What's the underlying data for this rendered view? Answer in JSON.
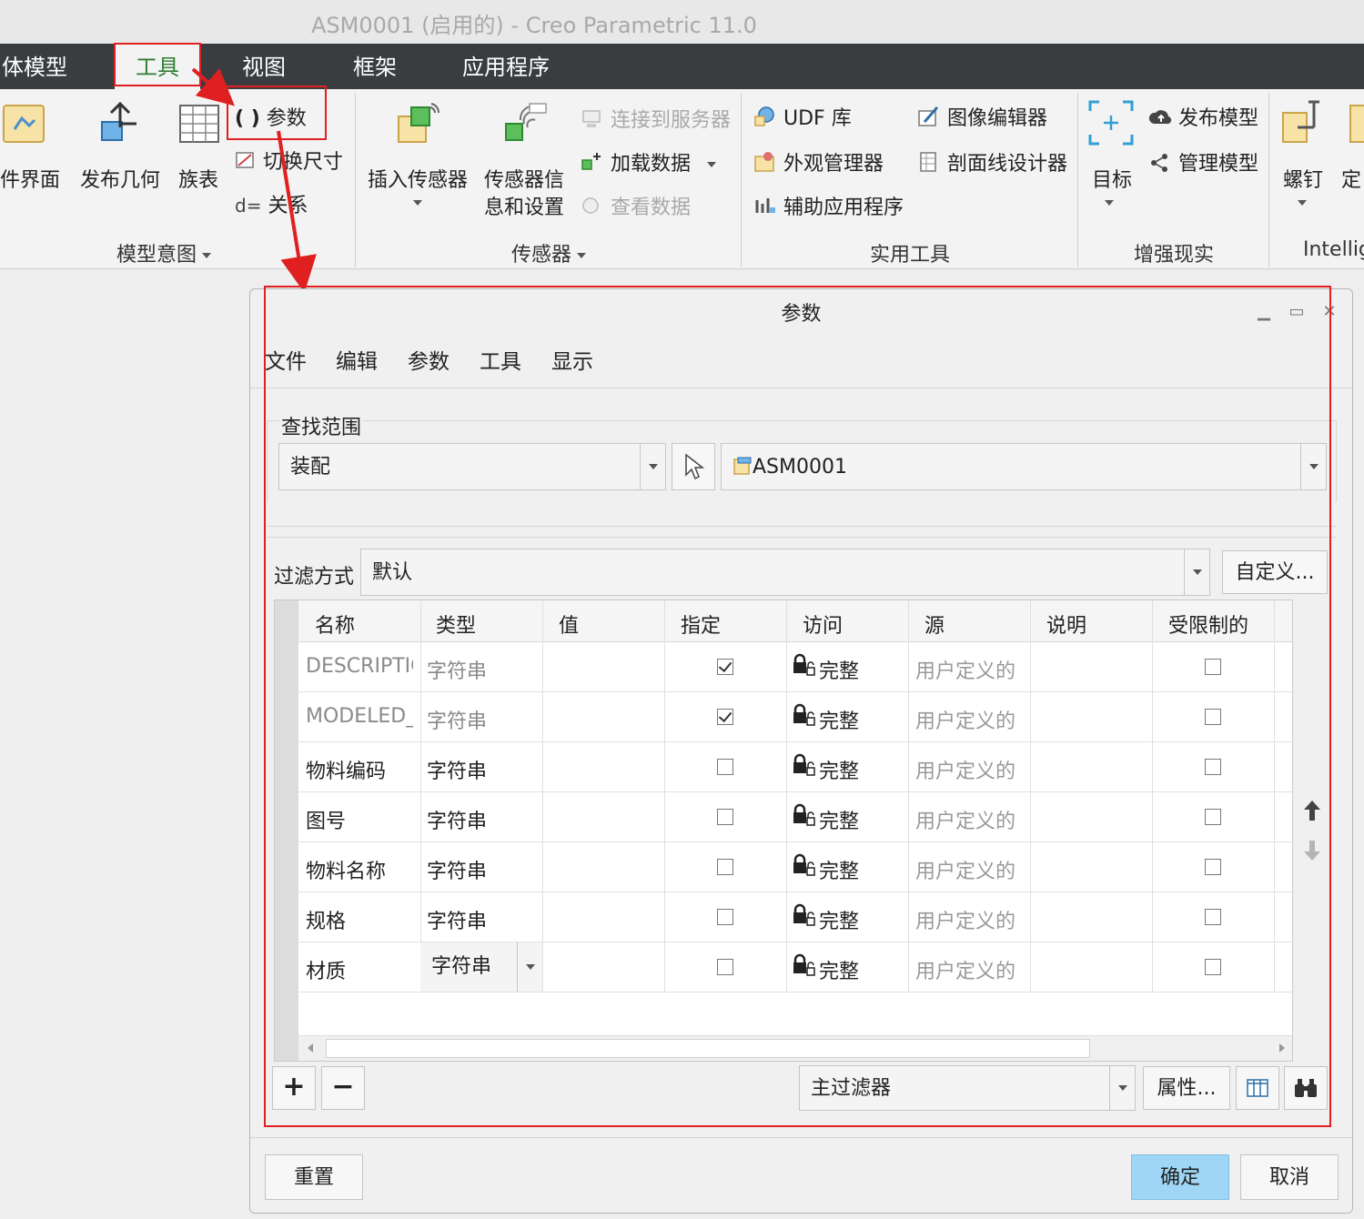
{
  "window": {
    "title": "ASM0001 (启用的) - Creo Parametric 11.0"
  },
  "tabs": [
    {
      "label": "体模型"
    },
    {
      "label": "工具",
      "active": true
    },
    {
      "label": "视图"
    },
    {
      "label": "框架"
    },
    {
      "label": "应用程序"
    }
  ],
  "ribbon": {
    "model_intent": {
      "label": "模型意图",
      "items": [
        "件界面",
        "发布几何",
        "族表"
      ],
      "small_items": [
        "参数",
        "切换尺寸",
        "关系"
      ],
      "relation_prefix": "d="
    },
    "sensor": {
      "label": "传感器",
      "insert": "插入传感器",
      "info_line1": "传感器信",
      "info_line2": "息和设置",
      "connect": "连接到服务器",
      "load": "加载数据",
      "view": "查看数据"
    },
    "utilities": {
      "label": "实用工具",
      "udf": "UDF 库",
      "appearance": "外观管理器",
      "aux": "辅助应用程序",
      "image_editor": "图像编辑器",
      "hatch": "剖面线设计器"
    },
    "ar": {
      "label": "增强现实",
      "target": "目标",
      "publish": "发布模型",
      "manage": "管理模型"
    },
    "intelli": {
      "label": "Intellig",
      "bolt": "螺钉",
      "define": "定"
    }
  },
  "dialog": {
    "title": "参数",
    "menu": [
      "文件",
      "编辑",
      "参数",
      "工具",
      "显示"
    ],
    "scope_label": "查找范围",
    "scope_value": "装配",
    "model_value": "ASM0001",
    "filter_label": "过滤方式",
    "filter_value": "默认",
    "customize_label": "自定义...",
    "columns": [
      "名称",
      "类型",
      "值",
      "指定",
      "访问",
      "源",
      "说明",
      "受限制的"
    ],
    "rows": [
      {
        "name": "DESCRIPTIC",
        "type": "字符串",
        "designated": true,
        "access": "完整",
        "source": "用户定义的",
        "restricted": false,
        "dim": true
      },
      {
        "name": "MODELED_",
        "type": "字符串",
        "designated": true,
        "access": "完整",
        "source": "用户定义的",
        "restricted": false,
        "dim": true
      },
      {
        "name": "物料编码",
        "type": "字符串",
        "designated": false,
        "access": "完整",
        "source": "用户定义的",
        "restricted": false,
        "dim": false
      },
      {
        "name": "图号",
        "type": "字符串",
        "designated": false,
        "access": "完整",
        "source": "用户定义的",
        "restricted": false,
        "dim": false
      },
      {
        "name": "物料名称",
        "type": "字符串",
        "designated": false,
        "access": "完整",
        "source": "用户定义的",
        "restricted": false,
        "dim": false
      },
      {
        "name": "规格",
        "type": "字符串",
        "designated": false,
        "access": "完整",
        "source": "用户定义的",
        "restricted": false,
        "dim": false
      },
      {
        "name": "材质",
        "type": "字符串",
        "designated": false,
        "access": "完整",
        "source": "用户定义的",
        "restricted": false,
        "dim": false,
        "type_dropdown": true
      }
    ],
    "add_label": "+",
    "remove_label": "−",
    "main_filter": "主过滤器",
    "properties_label": "属性...",
    "reset_label": "重置",
    "ok_label": "确定",
    "cancel_label": "取消"
  },
  "colors": {
    "tabbar": "#3a3d40",
    "active_tab_text": "#2e7d32",
    "highlight_red": "#e02020",
    "primary_button": "#9fd6f5"
  }
}
